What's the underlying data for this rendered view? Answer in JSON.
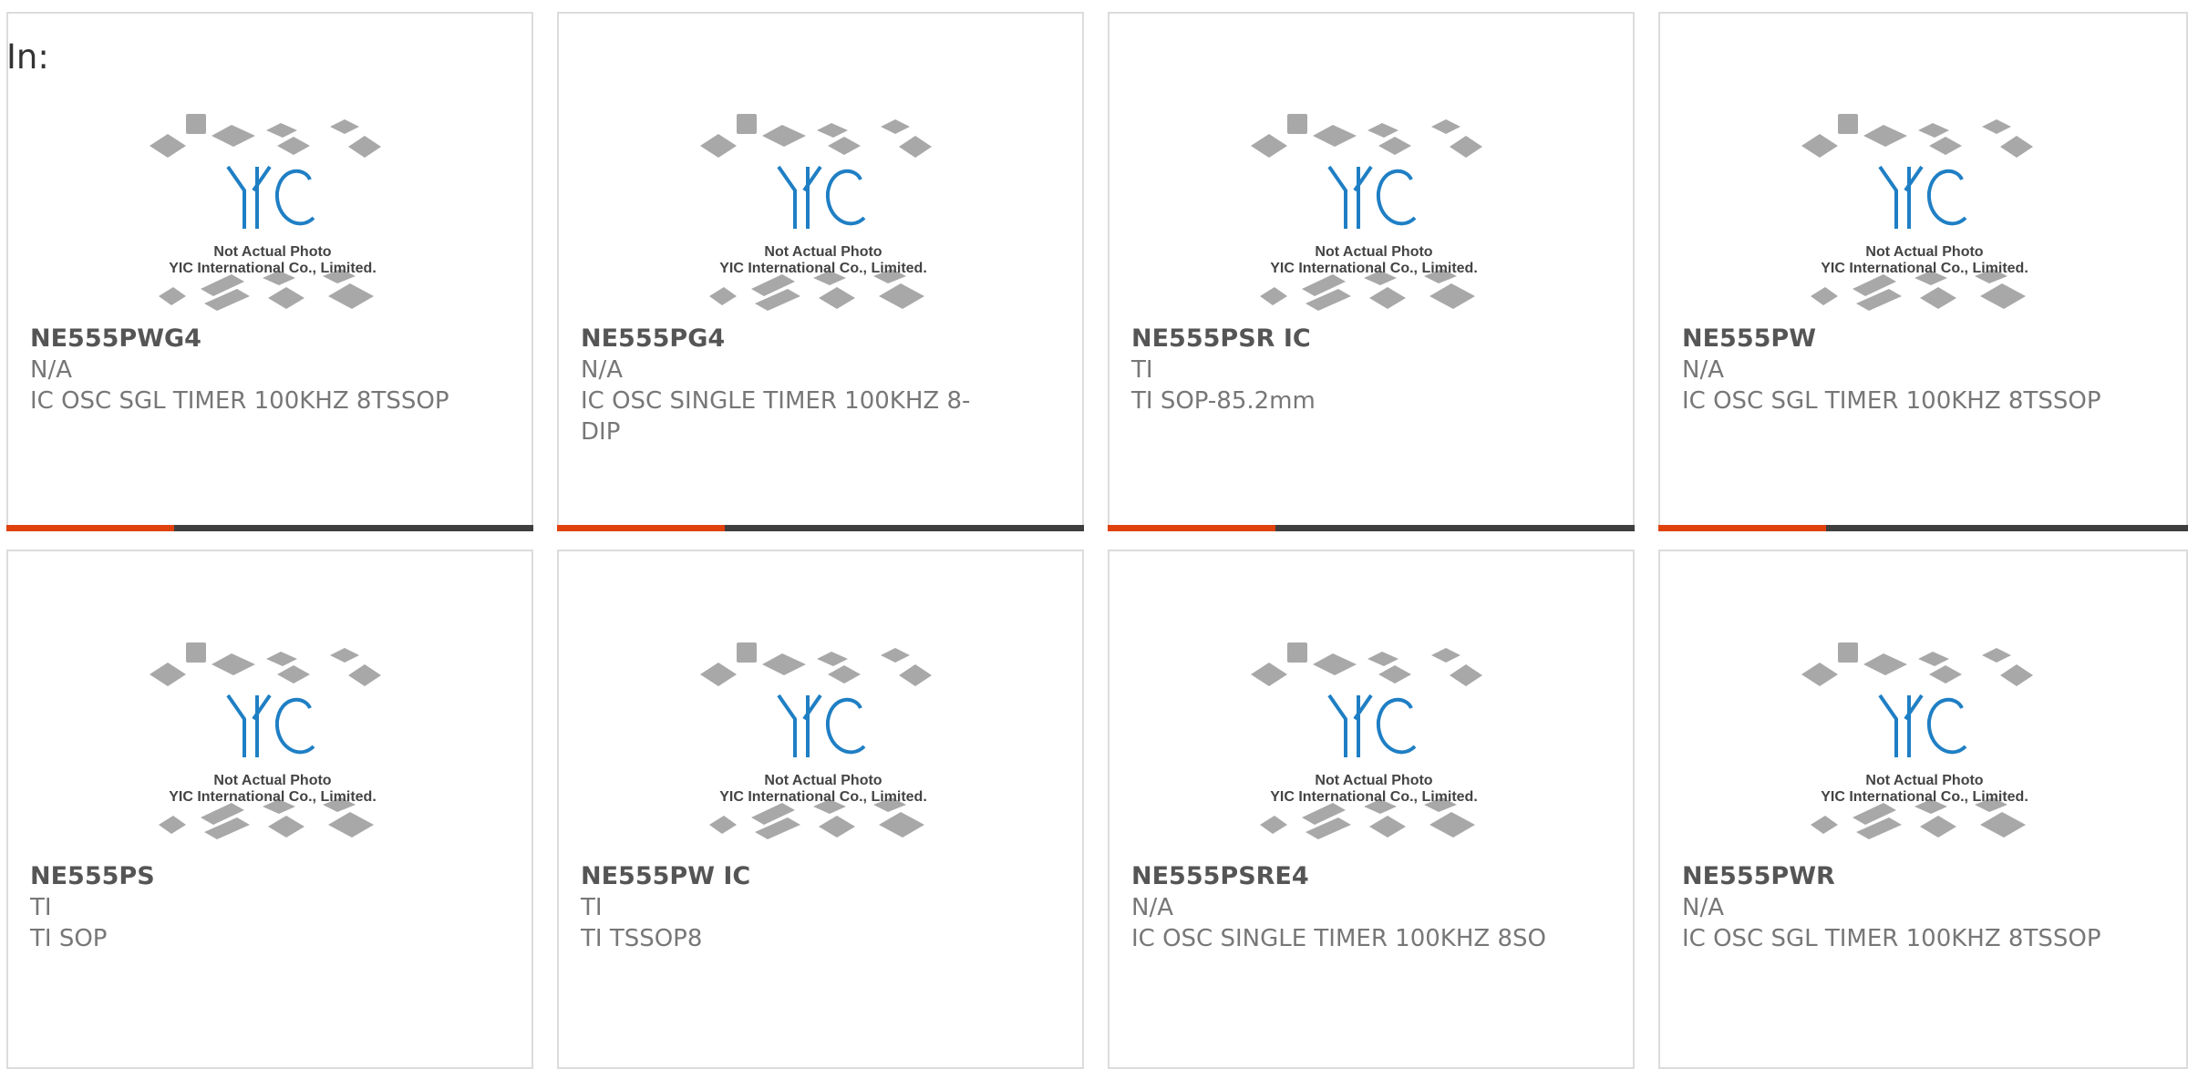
{
  "header": {
    "in_label": "In:"
  },
  "photo": {
    "logo_text": "YIC",
    "line1": "Not Actual Photo",
    "line2": "YIC International Co., Limited."
  },
  "products": [
    {
      "part": "NE555PWG4",
      "mfr": "N/A",
      "desc": "IC OSC SGL TIMER 100KHZ 8TSSOP"
    },
    {
      "part": "NE555PG4",
      "mfr": "N/A",
      "desc": "IC OSC SINGLE TIMER 100KHZ 8-DIP"
    },
    {
      "part": "NE555PSR IC",
      "mfr": "TI",
      "desc": "TI SOP-85.2mm"
    },
    {
      "part": "NE555PW",
      "mfr": "N/A",
      "desc": "IC OSC SGL TIMER 100KHZ 8TSSOP"
    },
    {
      "part": "NE555PS",
      "mfr": "TI",
      "desc": "TI SOP"
    },
    {
      "part": "NE555PW IC",
      "mfr": "TI",
      "desc": "TI TSSOP8"
    },
    {
      "part": "NE555PSRE4",
      "mfr": "N/A",
      "desc": "IC OSC SINGLE TIMER 100KHZ 8SO"
    },
    {
      "part": "NE555PWR",
      "mfr": "N/A",
      "desc": "IC OSC SGL TIMER 100KHZ 8TSSOP"
    }
  ],
  "colors": {
    "accent": "#e0420e",
    "bar": "#3f3f3f",
    "logo": "#1f7fc4"
  }
}
